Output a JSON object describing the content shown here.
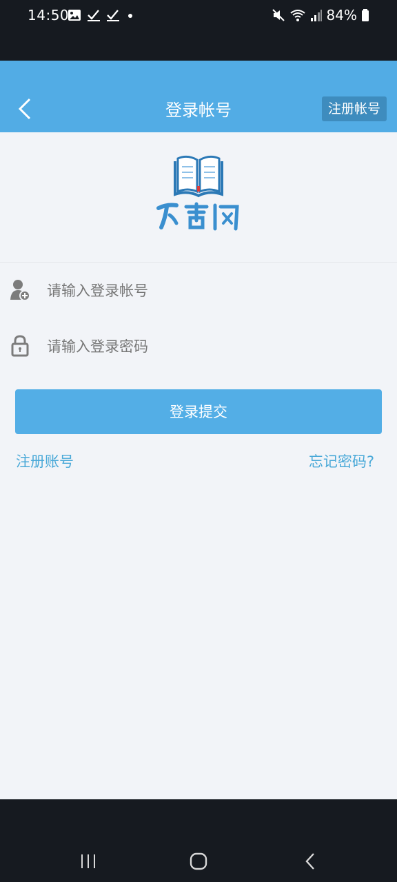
{
  "status_bar": {
    "time": "14:50",
    "battery": "84%",
    "icons": [
      "gallery-icon",
      "check-icon",
      "check-icon",
      "dot-icon",
      "mute-icon",
      "wifi-icon",
      "signal-icon",
      "battery-icon"
    ]
  },
  "header": {
    "title": "登录帐号",
    "register_label": "注册帐号"
  },
  "form": {
    "account_placeholder": "请输入登录帐号",
    "password_placeholder": "请输入登录密码",
    "submit_label": "登录提交"
  },
  "links": {
    "register": "注册账号",
    "forgot_password": "忘记密码?"
  },
  "colors": {
    "primary": "#52ace5",
    "link": "#4aa9d8",
    "background": "#f2f4f8",
    "system_bar": "#161a20"
  },
  "logo": {
    "text": "下书网"
  }
}
